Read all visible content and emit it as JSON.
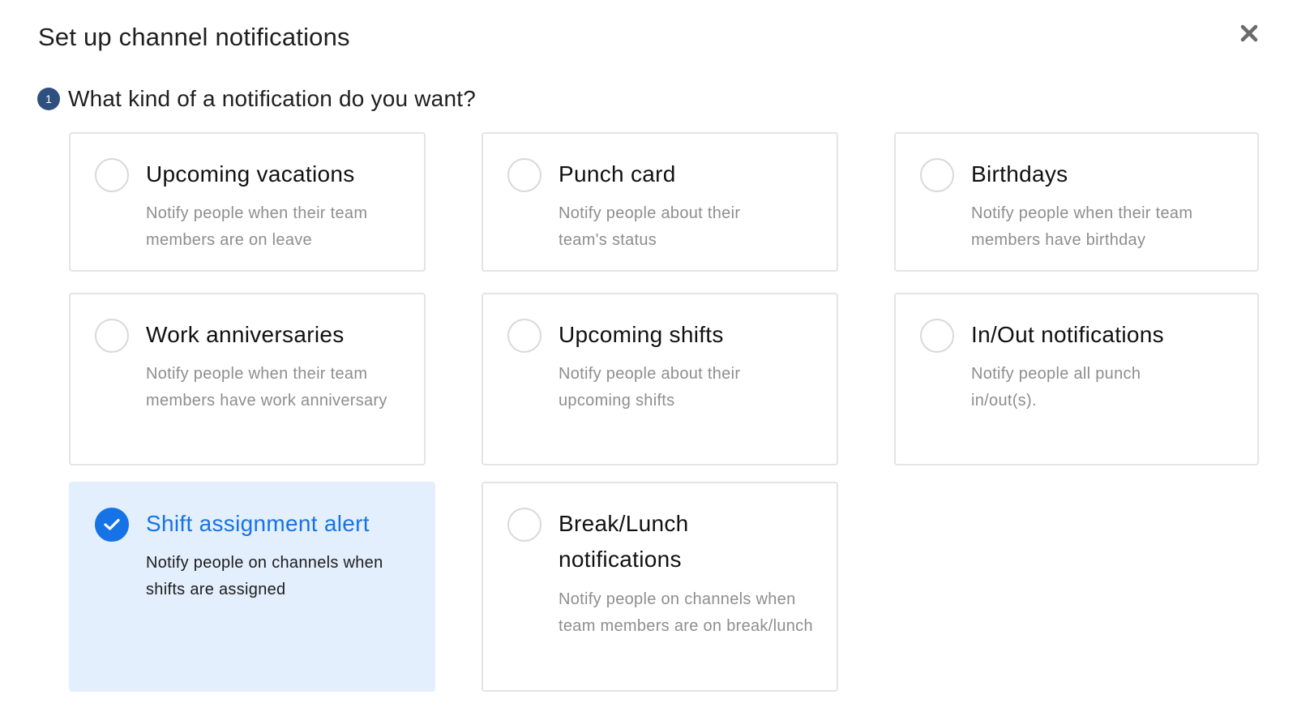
{
  "dialog": {
    "title": "Set up channel notifications",
    "close_icon": "close-icon"
  },
  "step": {
    "number": "1",
    "question": "What kind of a notification do you want?"
  },
  "options": [
    {
      "title": "Upcoming vacations",
      "description": "Notify people when their team members are on leave",
      "selected": false
    },
    {
      "title": "Punch card",
      "description": "Notify people about their team's status",
      "selected": false
    },
    {
      "title": "Birthdays",
      "description": "Notify people when their team members have birthday",
      "selected": false
    },
    {
      "title": "Work anniversaries",
      "description": "Notify people when their team members have work anniversary",
      "selected": false
    },
    {
      "title": "Upcoming shifts",
      "description": "Notify people about their upcoming shifts",
      "selected": false
    },
    {
      "title": "In/Out notifications",
      "description": "Notify people all punch in/out(s).",
      "selected": false
    },
    {
      "title": "Shift assignment alert",
      "description": "Notify people on channels when shifts are assigned",
      "selected": true
    },
    {
      "title": "Break/Lunch notifications",
      "description": "Notify people on channels when team members are on break/lunch",
      "selected": false
    }
  ],
  "colors": {
    "accent": "#1673e6",
    "selected_bg": "#e3effc",
    "step_badge": "#2f4f7e"
  }
}
